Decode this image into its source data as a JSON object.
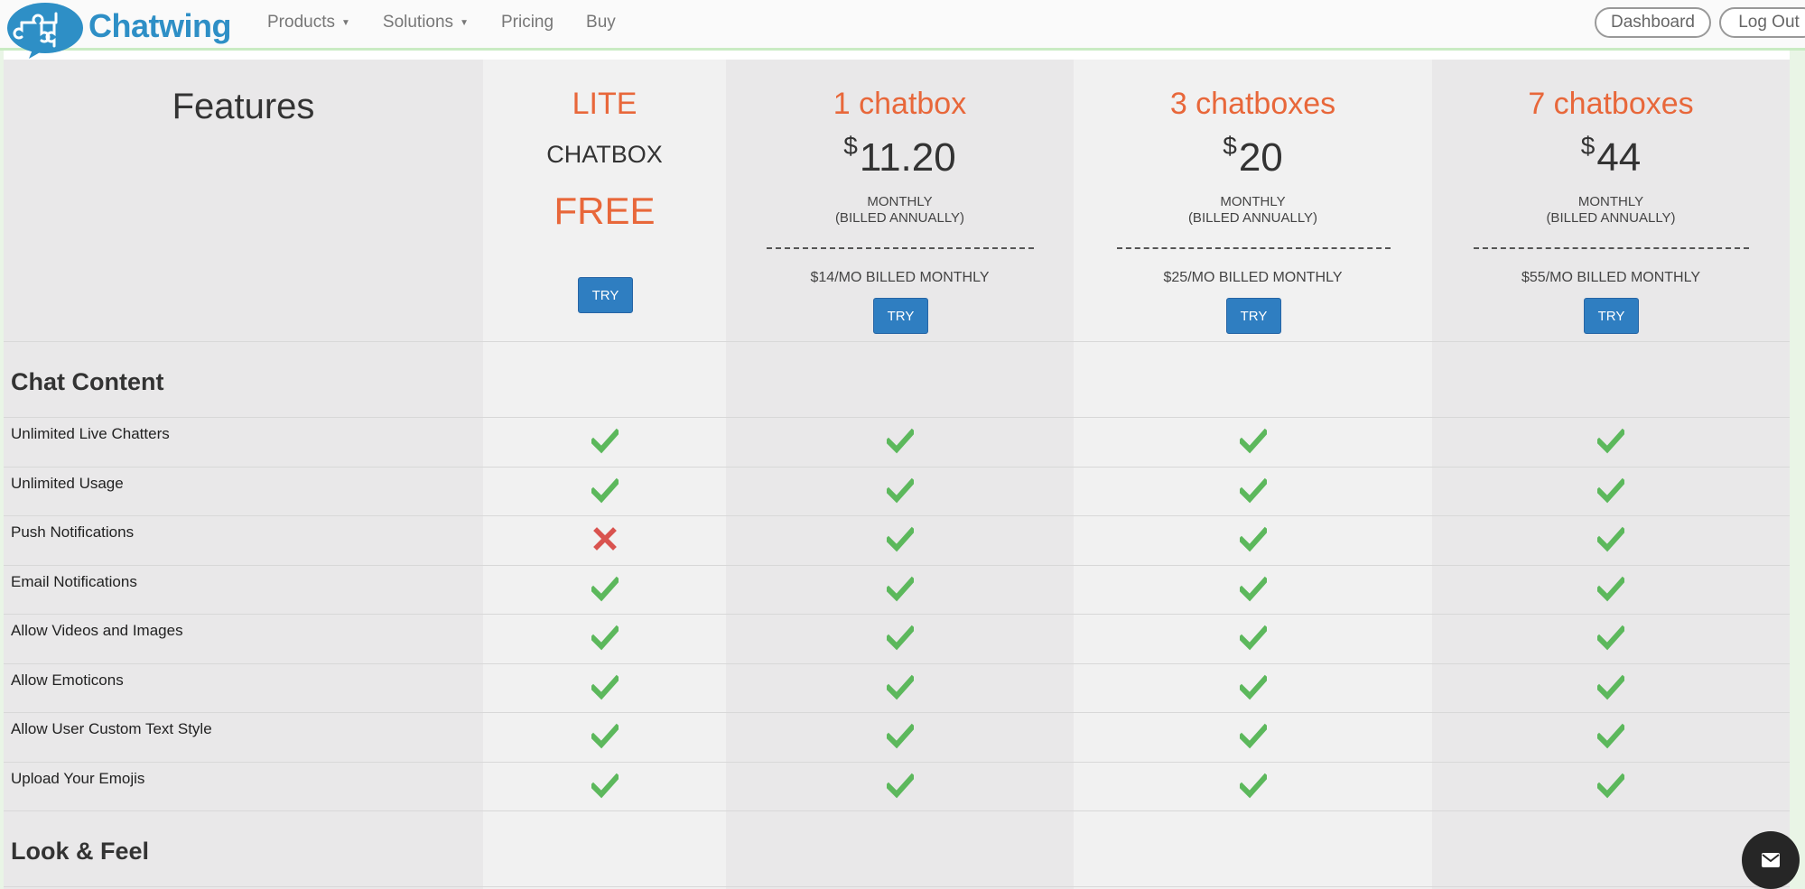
{
  "header": {
    "brand": "Chatwing",
    "nav": [
      {
        "label": "Products",
        "dropdown": true
      },
      {
        "label": "Solutions",
        "dropdown": true
      },
      {
        "label": "Pricing",
        "dropdown": false
      },
      {
        "label": "Buy",
        "dropdown": false
      }
    ],
    "dashboard_label": "Dashboard",
    "logout_label": "Log Out"
  },
  "table": {
    "features_title": "Features",
    "plans": [
      {
        "name": "LITE",
        "sub": "CHATBOX",
        "price_text": "FREE",
        "try_label": "TRY"
      },
      {
        "name": "1 chatbox",
        "currency": "$",
        "price": "11.20",
        "billing1": "MONTHLY",
        "billing2": "(BILLED ANNUALLY)",
        "monthly": "$14/MO BILLED MONTHLY",
        "try_label": "TRY"
      },
      {
        "name": "3 chatboxes",
        "currency": "$",
        "price": "20",
        "billing1": "MONTHLY",
        "billing2": "(BILLED ANNUALLY)",
        "monthly": "$25/MO BILLED MONTHLY",
        "try_label": "TRY"
      },
      {
        "name": "7 chatboxes",
        "currency": "$",
        "price": "44",
        "billing1": "MONTHLY",
        "billing2": "(BILLED ANNUALLY)",
        "monthly": "$55/MO BILLED MONTHLY",
        "try_label": "TRY"
      }
    ],
    "sections": [
      {
        "title": "Chat Content",
        "features": [
          {
            "label": "Unlimited Live Chatters",
            "values": [
              true,
              true,
              true,
              true
            ]
          },
          {
            "label": "Unlimited Usage",
            "values": [
              true,
              true,
              true,
              true
            ]
          },
          {
            "label": "Push Notifications",
            "values": [
              false,
              true,
              true,
              true
            ]
          },
          {
            "label": "Email Notifications",
            "values": [
              true,
              true,
              true,
              true
            ]
          },
          {
            "label": "Allow Videos and Images",
            "values": [
              true,
              true,
              true,
              true
            ]
          },
          {
            "label": "Allow Emoticons",
            "values": [
              true,
              true,
              true,
              true
            ]
          },
          {
            "label": "Allow User Custom Text Style",
            "values": [
              true,
              true,
              true,
              true
            ]
          },
          {
            "label": "Upload Your Emojis",
            "values": [
              true,
              true,
              true,
              true
            ]
          }
        ]
      },
      {
        "title": "Look & Feel",
        "features": []
      }
    ]
  },
  "icons": {
    "check": "check-icon",
    "cross": "cross-icon",
    "envelope": "envelope-icon"
  },
  "colors": {
    "accent_orange": "#e8673a",
    "button_blue": "#2f7ec1",
    "check_green": "#5cb85c",
    "cross_red": "#d9534f",
    "brand_blue": "#2e8fc6"
  }
}
